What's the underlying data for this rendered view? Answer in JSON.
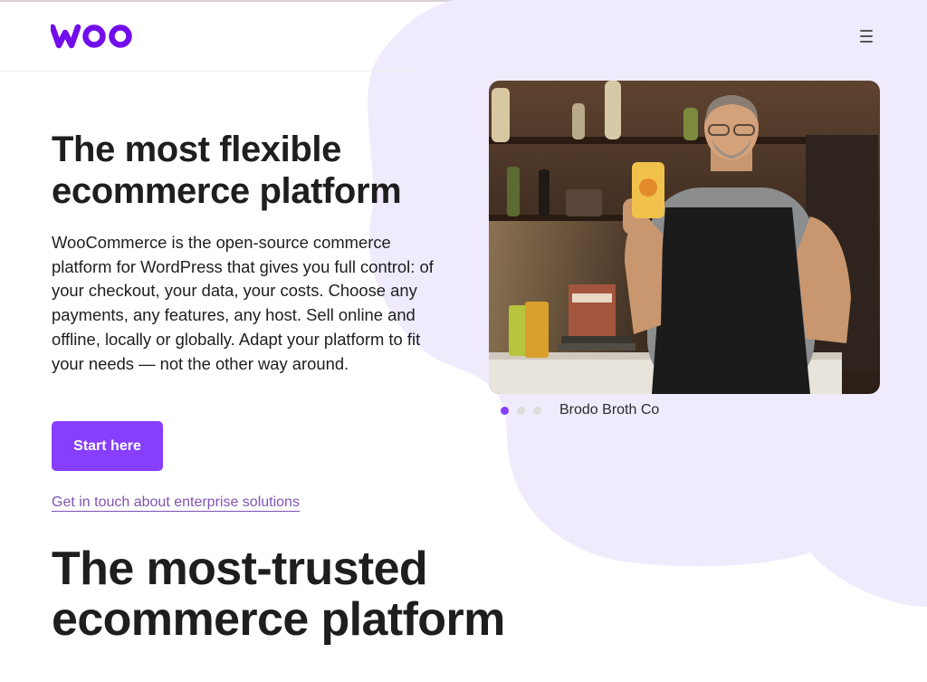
{
  "header": {
    "logo_text": "woo",
    "menu_icon": "hamburger-menu-icon"
  },
  "hero": {
    "title_line1": "The most flexible",
    "title_line2": "ecommerce platform",
    "description": "WooCommerce is the open-source commerce platform for WordPress that gives you full control: of your checkout, your data, your costs. Choose any payments, any features, any host. Sell online and offline, locally or globally. Adapt your platform to fit your needs — not the other way around.",
    "cta_label": "Start here",
    "enterprise_link": "Get in touch about enterprise solutions"
  },
  "carousel": {
    "caption": "Brodo Broth Co",
    "active_index": 0,
    "slide_count": 3
  },
  "section2": {
    "title_line1": "The most-trusted",
    "title_line2": "ecommerce platform"
  },
  "colors": {
    "brand_purple": "#873eff",
    "logo_purple": "#720eec",
    "blob_lavender": "#f0eafd",
    "link_purple": "#7f54b3"
  }
}
